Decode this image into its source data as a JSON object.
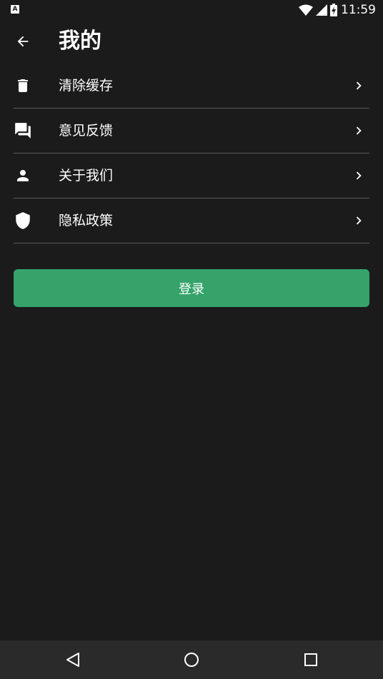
{
  "status_bar": {
    "left_icon": "A",
    "icons": [
      "wifi-icon",
      "signal-icon",
      "battery-charging-icon"
    ],
    "time": "11:59"
  },
  "app_bar": {
    "back_icon": "arrow-back-icon",
    "title": "我的"
  },
  "menu": {
    "items": [
      {
        "icon": "trash-icon",
        "label": "清除缓存"
      },
      {
        "icon": "chat-icon",
        "label": "意见反馈"
      },
      {
        "icon": "person-icon",
        "label": "关于我们"
      },
      {
        "icon": "shield-icon",
        "label": "隐私政策"
      }
    ],
    "chevron_icon": "chevron-right-icon"
  },
  "login": {
    "label": "登录"
  },
  "colors": {
    "background": "#1b1b1b",
    "accent": "#35a36a",
    "divider": "#5a5a5a",
    "nav_bar": "#2a2a2a"
  },
  "nav_bar": {
    "icons": [
      "nav-back-icon",
      "nav-home-icon",
      "nav-recents-icon"
    ]
  }
}
